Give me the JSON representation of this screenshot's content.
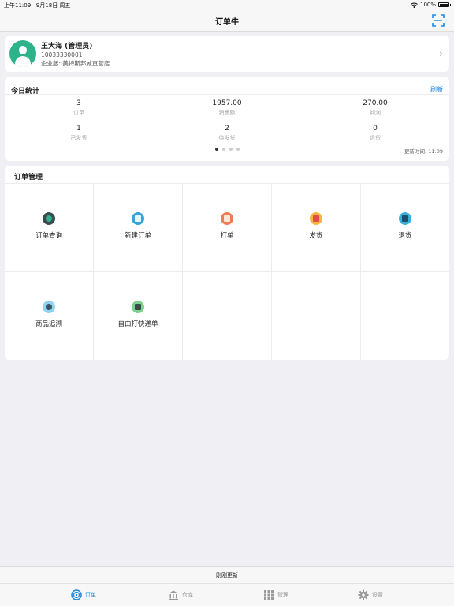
{
  "status": {
    "time": "上午11:09",
    "date": "9月18日 周五",
    "battery": "100%"
  },
  "nav": {
    "title": "订单牛",
    "scan_icon": "scan-icon"
  },
  "profile": {
    "name": "王大海 (管理员)",
    "id": "10033330001",
    "org": "企业版: 美特斯邦威直营店"
  },
  "stats": {
    "title": "今日统计",
    "refresh": "刷新",
    "items": [
      {
        "value": "3",
        "label": "订单"
      },
      {
        "value": "1957.00",
        "label": "销售额"
      },
      {
        "value": "270.00",
        "label": "利润"
      },
      {
        "value": "1",
        "label": "已发货"
      },
      {
        "value": "2",
        "label": "待发货"
      },
      {
        "value": "0",
        "label": "退货"
      }
    ],
    "update_time": "更新时间: 11:09"
  },
  "orders": {
    "title": "订单管理",
    "items": [
      {
        "label": "订单查询",
        "icon": "order-query-icon",
        "color": "#3c4a52",
        "inner": "#2db38a"
      },
      {
        "label": "新建订单",
        "icon": "new-order-icon",
        "color": "#38a3d8",
        "inner": "#e8f6fc"
      },
      {
        "label": "打单",
        "icon": "print-order-icon",
        "color": "#f07c55",
        "inner": "#ffe6d6"
      },
      {
        "label": "发货",
        "icon": "ship-icon",
        "color": "#f6b73c",
        "inner": "#e04b4b"
      },
      {
        "label": "退货",
        "icon": "return-icon",
        "color": "#3bb0d6",
        "inner": "#1f4e6b"
      },
      {
        "label": "商品追溯",
        "icon": "trace-icon",
        "color": "#8fd3f0",
        "inner": "#3a5563"
      },
      {
        "label": "自由打快递单",
        "icon": "express-print-icon",
        "color": "#7fd08f",
        "inner": "#3a4a44"
      }
    ]
  },
  "refresh_bar": {
    "text": "刚刚更新"
  },
  "tabs": [
    {
      "label": "订单",
      "icon": "order-tab-icon",
      "active": true
    },
    {
      "label": "仓库",
      "icon": "warehouse-icon",
      "active": false
    },
    {
      "label": "管理",
      "icon": "grid-icon",
      "active": false
    },
    {
      "label": "设置",
      "icon": "gear-icon",
      "active": false
    }
  ],
  "colors": {
    "accent": "#1e88e5",
    "avatar": "#2db38a",
    "background": "#efeff4"
  }
}
